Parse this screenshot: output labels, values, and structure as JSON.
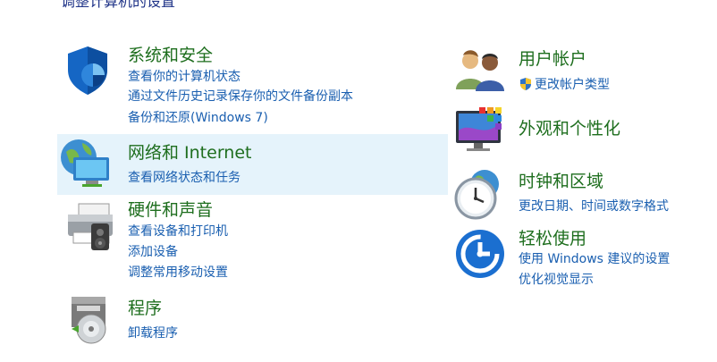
{
  "header": {
    "cut_title": "调整计算机的设置"
  },
  "left": [
    {
      "title": "系统和安全",
      "icon": "shield-security-icon",
      "links": [
        "查看你的计算机状态",
        "通过文件历史记录保存你的文件备份副本",
        "备份和还原(Windows 7)"
      ]
    },
    {
      "title": "网络和 Internet",
      "icon": "network-globe-icon",
      "links": [
        "查看网络状态和任务"
      ]
    },
    {
      "title": "硬件和声音",
      "icon": "printer-speaker-icon",
      "links": [
        "查看设备和打印机",
        "添加设备",
        "调整常用移动设置"
      ]
    },
    {
      "title": "程序",
      "icon": "programs-disc-icon",
      "links": [
        "卸载程序"
      ]
    }
  ],
  "right": [
    {
      "title": "用户帐户",
      "icon": "users-icon",
      "links": [
        "更改帐户类型"
      ]
    },
    {
      "title": "外观和个性化",
      "icon": "monitor-palette-icon",
      "links": []
    },
    {
      "title": "时钟和区域",
      "icon": "clock-globe-icon",
      "links": [
        "更改日期、时间或数字格式"
      ]
    },
    {
      "title": "轻松使用",
      "icon": "ease-of-access-icon",
      "links": [
        "使用 Windows 建议的设置",
        "优化视觉显示"
      ]
    }
  ],
  "colors": {
    "title_green": "#1e6e1e",
    "link_blue": "#1a5fb0",
    "hover_bg": "#e5f3fb"
  }
}
